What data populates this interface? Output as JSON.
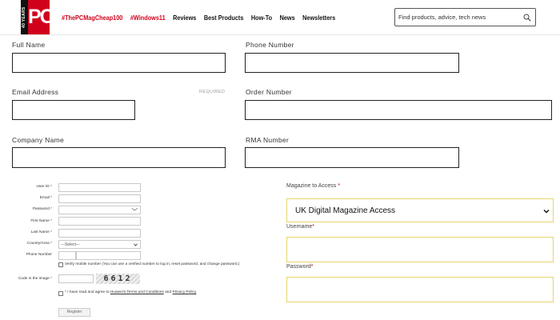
{
  "header": {
    "logo_years": "40 YEARS",
    "logo_text": "PC",
    "nav": [
      {
        "label": "#ThePCMagCheap100",
        "accent": true
      },
      {
        "label": "#Windows11",
        "accent": true
      },
      {
        "label": "Reviews",
        "accent": false
      },
      {
        "label": "Best Products",
        "accent": false
      },
      {
        "label": "How-To",
        "accent": false
      },
      {
        "label": "News",
        "accent": false
      },
      {
        "label": "Newsletters",
        "accent": false
      }
    ],
    "search_placeholder": "Find products, advice, tech news"
  },
  "contact_form": {
    "full_name_label": "Full Name",
    "phone_label": "Phone Number",
    "email_label": "Email Address",
    "required_label": "REQUIRED",
    "order_label": "Order Number",
    "company_label": "Company Name",
    "rma_label": "RMA Number"
  },
  "registration": {
    "user_id_label": "User ID",
    "email_label": "Email",
    "password_label": "Password",
    "password_hint": "*••*",
    "first_name_label": "First Name",
    "last_name_label": "Last Name",
    "country_label": "Country/Area",
    "country_select": "---Select---",
    "phone_label": "Phone Number",
    "verify_text": "Verify mobile number (You can use a verified number to log in, reset password, and change password.)",
    "code_label": "Code in the image",
    "captcha_text": "6612",
    "agree_prefix": "I have read and agree to",
    "agree_terms": "Huawei's Terms and Conditions",
    "agree_and": "and",
    "agree_privacy": "Privacy Policy",
    "register_label": "Register"
  },
  "magazine": {
    "access_label": "Magazine to Access",
    "access_value": "UK Digital Magazine Access",
    "username_label": "Username",
    "password_label": "Password"
  },
  "colors": {
    "brand_red": "#d0021b",
    "required_star": "#cc0000",
    "field_highlight": "#e6d66a"
  }
}
